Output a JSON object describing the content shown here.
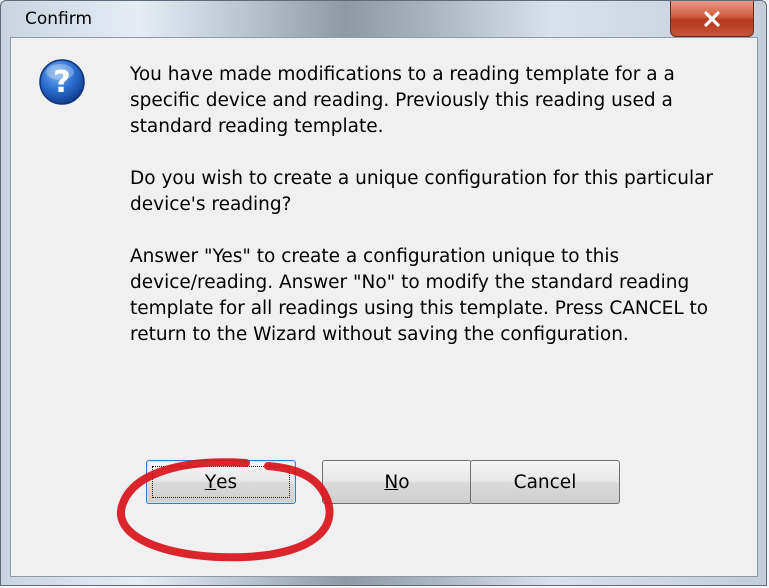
{
  "window": {
    "title": "Confirm"
  },
  "dialog": {
    "icon": "question-icon",
    "paragraphs": [
      "You have made modifications to a reading template for a a specific device and reading. Previously this reading used a standard reading template.",
      "Do you wish to create a unique configuration for this particular device's reading?",
      "Answer \"Yes\" to create a configuration unique to this device/reading. Answer \"No\" to modify the standard reading template for all readings using this template. Press CANCEL to return to the Wizard without saving the configuration."
    ]
  },
  "buttons": {
    "yes_mnemonic": "Y",
    "yes_rest": "es",
    "no_mnemonic": "N",
    "no_rest": "o",
    "cancel": "Cancel"
  },
  "annotation": {
    "color": "#d9141b"
  },
  "colors": {
    "close_button": "#c8553a",
    "dialog_background": "#f0f0f0",
    "question_icon": "#1f5fbf"
  }
}
